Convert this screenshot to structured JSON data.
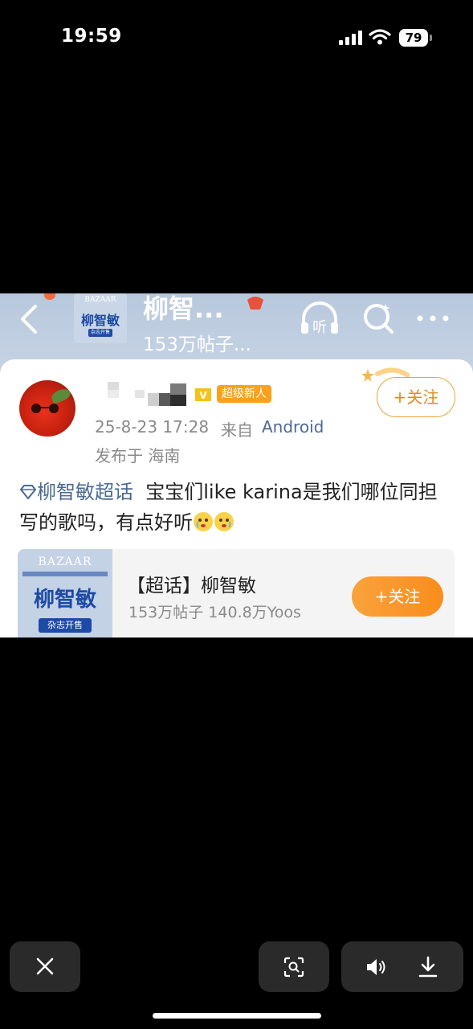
{
  "status_bar": {
    "time": "19:59",
    "battery": "79"
  },
  "screenshot": {
    "header": {
      "title": "柳智...",
      "subtitle": "153万帖子...",
      "thumb": {
        "brand": "BAZAAR",
        "name": "柳智敏",
        "tag": "杂志开售"
      },
      "listen_label": "听"
    },
    "post": {
      "badge": "超级新人",
      "time": "25-8-23 17:28",
      "source_prefix": "来自",
      "device": "Android",
      "location": "发布于 海南",
      "follow_label": "+关注",
      "topic": "柳智敏超话",
      "text": "宝宝们like karina是我们哪位同担写的歌吗，有点好听"
    },
    "topic_card": {
      "brand": "BAZAAR",
      "cover_name": "柳智敏",
      "cover_tag": "杂志开售",
      "title": "【超话】柳智敏",
      "stats": "153万帖子 140.8万Yoos",
      "follow_label": "+关注"
    }
  },
  "colors": {
    "accent_orange": "#f98d1d",
    "link_blue": "#4b6a93",
    "header_blue": "#b8c8dc"
  }
}
